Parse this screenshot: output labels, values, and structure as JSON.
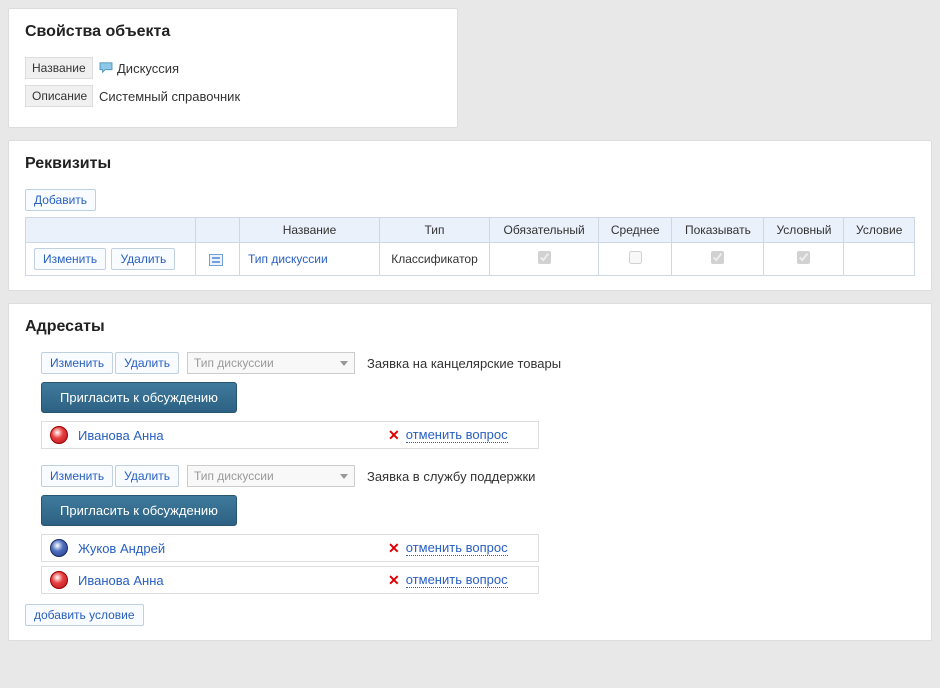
{
  "properties": {
    "title": "Свойства объекта",
    "name_label": "Название",
    "name_value": "Дискуссия",
    "desc_label": "Описание",
    "desc_value": "Системный справочник"
  },
  "requisites": {
    "title": "Реквизиты",
    "add_btn": "Добавить",
    "headers": {
      "name": "Название",
      "type": "Тип",
      "required": "Обязательный",
      "average": "Среднее",
      "show": "Показывать",
      "conditional": "Условный",
      "condition": "Условие"
    },
    "row": {
      "edit": "Изменить",
      "delete": "Удалить",
      "name": "Тип дискуссии",
      "type": "Классификатор",
      "required": true,
      "average": false,
      "show": true,
      "conditional": true
    }
  },
  "addressees": {
    "title": "Адресаты",
    "edit": "Изменить",
    "delete": "Удалить",
    "dropdown_placeholder": "Тип дискуссии",
    "invite_btn": "Пригласить к обсуждению",
    "cancel_text": "отменить вопрос",
    "add_condition": "добавить условие",
    "blocks": [
      {
        "title": "Заявка на канцелярские товары",
        "people": [
          {
            "name": "Иванова Анна",
            "avatar": "red"
          }
        ]
      },
      {
        "title": "Заявка в службу поддержки",
        "people": [
          {
            "name": "Жуков Андрей",
            "avatar": "blue"
          },
          {
            "name": "Иванова Анна",
            "avatar": "red"
          }
        ]
      }
    ]
  }
}
